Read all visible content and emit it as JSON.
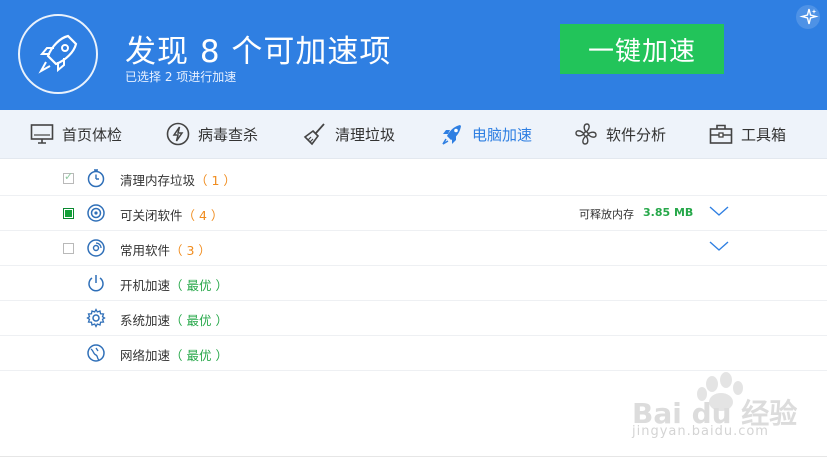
{
  "header": {
    "title": "发现 8 个可加速项",
    "subtitle": "已选择 2 项进行加速",
    "accelerate_button": "一键加速",
    "logo_icon": "rocket-icon",
    "corner_icon": "sparkle-icon"
  },
  "nav": {
    "tabs": [
      {
        "label": "首页体检",
        "icon": "monitor-icon"
      },
      {
        "label": "病毒查杀",
        "icon": "lightning-icon"
      },
      {
        "label": "清理垃圾",
        "icon": "broom-icon"
      },
      {
        "label": "电脑加速",
        "icon": "rocket-icon",
        "active": true
      },
      {
        "label": "软件分析",
        "icon": "fan-icon"
      },
      {
        "label": "工具箱",
        "icon": "toolbox-icon"
      }
    ]
  },
  "items": [
    {
      "label": "清理内存垃圾",
      "count": "（ 1 ）",
      "checkbox": "checked-light",
      "icon": "stopwatch-icon"
    },
    {
      "label": "可关闭软件",
      "count": "（ 4 ）",
      "checkbox": "checked",
      "icon": "target-icon",
      "memory_label": "可释放内存",
      "memory_value": "3.85 MB"
    },
    {
      "label": "常用软件",
      "count": "（ 3 ）",
      "checkbox": "unchecked",
      "icon": "disc-icon"
    },
    {
      "label": "开机加速",
      "status": "（ 最优 ）",
      "icon": "power-icon"
    },
    {
      "label": "系统加速",
      "status": "（ 最优 ）",
      "icon": "gear-icon"
    },
    {
      "label": "网络加速",
      "status": "（ 最优 ）",
      "icon": "network-icon"
    }
  ],
  "colors": {
    "header_bg": "#2f7fe2",
    "button_bg": "#22c45a",
    "count_orange": "#f08c1e",
    "best_green": "#27a84a",
    "active_blue": "#2f7fe2"
  },
  "watermark": {
    "text": "Bai du 经验",
    "sub": "jingyan.baidu.com"
  }
}
